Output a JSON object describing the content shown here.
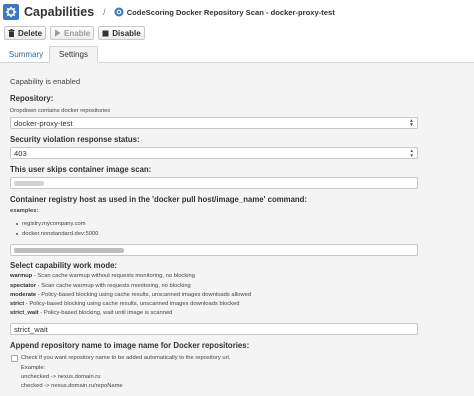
{
  "header": {
    "title": "Capabilities",
    "separator": "/",
    "subtitle": "CodeScoring Docker Repository Scan - docker-proxy-test"
  },
  "toolbar": {
    "delete_label": "Delete",
    "enable_label": "Enable",
    "disable_label": "Disable"
  },
  "tabs": {
    "summary": "Summary",
    "settings": "Settings"
  },
  "settings": {
    "status_text": "Capability is enabled",
    "repository": {
      "label": "Repository:",
      "help": "Dropdown contains docker repositories",
      "value": "docker-proxy-test"
    },
    "security": {
      "label": "Security violation response status:",
      "value": "403"
    },
    "skip_user": {
      "label": "This user skips container image scan:"
    },
    "registry_host": {
      "label": "Container registry host as used in the 'docker pull host/image_name' command:",
      "examples_label": "examples:",
      "examples": [
        "registry.mycompany.com",
        "docker.nonstandard.dev:5000"
      ]
    },
    "work_mode": {
      "label": "Select capability work mode:",
      "modes": [
        {
          "name": "warmup",
          "desc": " - Scan cache warmup without requests monitoring, no blocking"
        },
        {
          "name": "spectator",
          "desc": " - Scan cache warmup with requests monitoring, no blocking"
        },
        {
          "name": "moderate",
          "desc": " - Policy-based blocking using cache results, unscanned images downloads allowed"
        },
        {
          "name": "strict",
          "desc": " - Policy-based blocking using cache results, unscanned images downloads blocked"
        },
        {
          "name": "strict_wait",
          "desc": " - Policy-based blocking, wait until image is scanned"
        }
      ],
      "value": "strict_wait"
    },
    "append_name": {
      "label": "Append repository name to image name for Docker repositories:",
      "help": "Check if you want repository name to be added automatically to the repository url.",
      "example_label": "Example:",
      "unchecked": "unchecked -> nexus.domain.ru",
      "checked": "checked -> nexus.domain.ru/repoName"
    }
  },
  "colors": {
    "accent": "#2e6da4",
    "icon_blue": "#3a78c3",
    "panel_bg": "#f4f4f4"
  }
}
